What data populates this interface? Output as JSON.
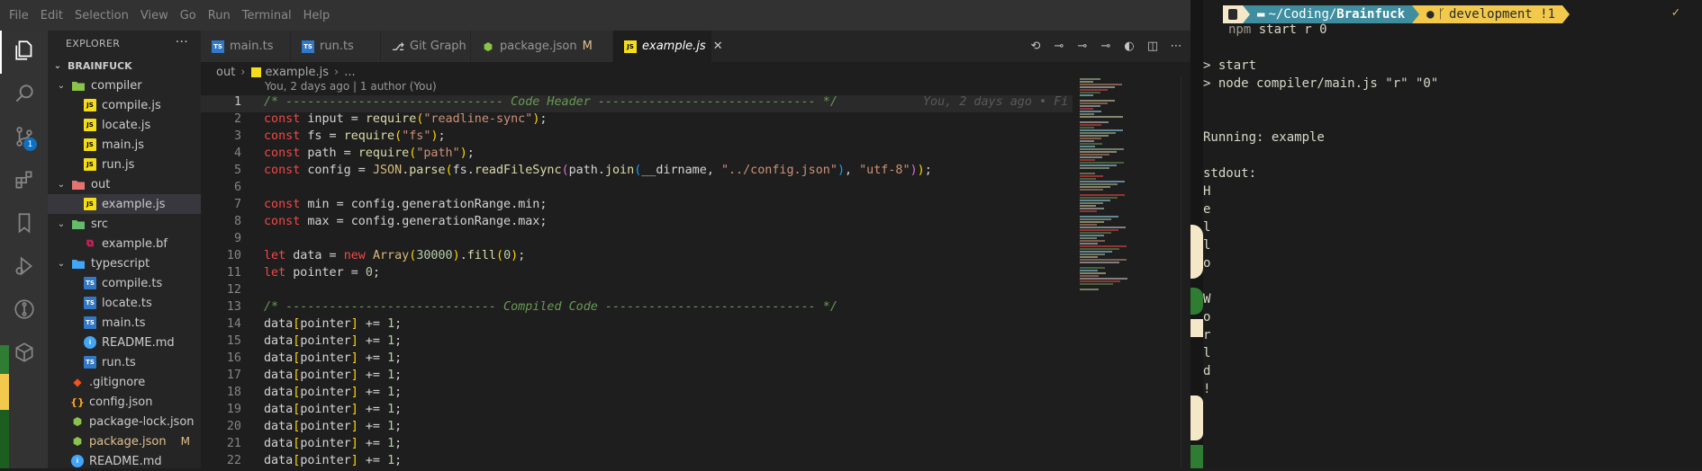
{
  "menubar": {
    "items": [
      "File",
      "Edit",
      "Selection",
      "View",
      "Go",
      "Run",
      "Terminal",
      "Help"
    ]
  },
  "activitybar": {
    "items": [
      {
        "name": "explorer",
        "icon": "files-icon"
      },
      {
        "name": "search",
        "icon": "search-icon"
      },
      {
        "name": "source-control",
        "icon": "source-control-icon",
        "badge": "1"
      },
      {
        "name": "extensions",
        "icon": "extensions-icon"
      },
      {
        "name": "bookmarks",
        "icon": "bookmark-icon"
      },
      {
        "name": "run-debug",
        "icon": "run-debug-icon"
      },
      {
        "name": "git-graph",
        "icon": "git-graph-icon"
      },
      {
        "name": "remote",
        "icon": "remote-icon"
      }
    ]
  },
  "explorer": {
    "title": "EXPLORER",
    "more": "···",
    "root": "BRAINFUCK",
    "tree": [
      {
        "label": "compiler",
        "type": "folder",
        "depth": 1,
        "open": true,
        "color": "#8bc34a"
      },
      {
        "label": "compile.js",
        "type": "js",
        "depth": 2
      },
      {
        "label": "locate.js",
        "type": "js",
        "depth": 2
      },
      {
        "label": "main.js",
        "type": "js",
        "depth": 2
      },
      {
        "label": "run.js",
        "type": "js",
        "depth": 2
      },
      {
        "label": "out",
        "type": "folder",
        "depth": 1,
        "open": true,
        "color": "#e57373"
      },
      {
        "label": "example.js",
        "type": "js",
        "depth": 2,
        "selected": true
      },
      {
        "label": "src",
        "type": "folder",
        "depth": 1,
        "open": true,
        "color": "#66bb6a"
      },
      {
        "label": "example.bf",
        "type": "bf",
        "depth": 2
      },
      {
        "label": "typescript",
        "type": "folder",
        "depth": 1,
        "open": true,
        "color": "#42a5f5"
      },
      {
        "label": "compile.ts",
        "type": "ts",
        "depth": 2
      },
      {
        "label": "locate.ts",
        "type": "ts",
        "depth": 2
      },
      {
        "label": "main.ts",
        "type": "ts",
        "depth": 2
      },
      {
        "label": "README.md",
        "type": "md",
        "depth": 2
      },
      {
        "label": "run.ts",
        "type": "ts",
        "depth": 2
      },
      {
        "label": ".gitignore",
        "type": "git",
        "depth": 1
      },
      {
        "label": "config.json",
        "type": "json",
        "depth": 1
      },
      {
        "label": "package-lock.json",
        "type": "pkg",
        "depth": 1
      },
      {
        "label": "package.json",
        "type": "pkg",
        "depth": 1,
        "git": "M"
      },
      {
        "label": "README.md",
        "type": "md",
        "depth": 1
      }
    ]
  },
  "tabs": [
    {
      "label": "main.ts",
      "type": "ts"
    },
    {
      "label": "run.ts",
      "type": "ts"
    },
    {
      "label": "Git Graph",
      "type": "git-graph"
    },
    {
      "label": "package.json",
      "type": "pkg",
      "git": "M"
    },
    {
      "label": "example.js",
      "type": "js",
      "active": true,
      "close": "✕"
    }
  ],
  "breadcrumb": {
    "folder": "out",
    "file": "example.js",
    "more": "..."
  },
  "blame": {
    "header": "You, 2 days ago | 1 author (You)",
    "inline": "You, 2 days ago • Fi"
  },
  "editor": {
    "current_line": 1,
    "lines": [
      {
        "n": "1",
        "tokens": [
          [
            "cm",
            "/* ------------------------------ Code Header ------------------------------ */"
          ]
        ]
      },
      {
        "n": "2",
        "tokens": [
          [
            "kw",
            "const "
          ],
          [
            "var",
            "input"
          ],
          [
            "plain",
            " = "
          ],
          [
            "fn",
            "require"
          ],
          [
            "br1",
            "("
          ],
          [
            "str",
            "\"readline-sync\""
          ],
          [
            "br1",
            ")"
          ],
          [
            "plain",
            ";"
          ]
        ]
      },
      {
        "n": "3",
        "tokens": [
          [
            "kw",
            "const "
          ],
          [
            "var",
            "fs"
          ],
          [
            "plain",
            " = "
          ],
          [
            "fn",
            "require"
          ],
          [
            "br1",
            "("
          ],
          [
            "str",
            "\"fs\""
          ],
          [
            "br1",
            ")"
          ],
          [
            "plain",
            ";"
          ]
        ]
      },
      {
        "n": "4",
        "tokens": [
          [
            "kw",
            "const "
          ],
          [
            "var",
            "path"
          ],
          [
            "plain",
            " = "
          ],
          [
            "fn",
            "require"
          ],
          [
            "br1",
            "("
          ],
          [
            "str",
            "\"path\""
          ],
          [
            "br1",
            ")"
          ],
          [
            "plain",
            ";"
          ]
        ]
      },
      {
        "n": "5",
        "tokens": [
          [
            "kw",
            "const "
          ],
          [
            "var",
            "config"
          ],
          [
            "plain",
            " = "
          ],
          [
            "yel",
            "JSON"
          ],
          [
            "plain",
            "."
          ],
          [
            "fn",
            "parse"
          ],
          [
            "br1",
            "("
          ],
          [
            "var",
            "fs"
          ],
          [
            "plain",
            "."
          ],
          [
            "fn",
            "readFileSync"
          ],
          [
            "br2",
            "("
          ],
          [
            "var",
            "path"
          ],
          [
            "plain",
            "."
          ],
          [
            "fn",
            "join"
          ],
          [
            "br3",
            "("
          ],
          [
            "var",
            "__dirname"
          ],
          [
            "plain",
            ", "
          ],
          [
            "str",
            "\"../config.json\""
          ],
          [
            "br3",
            ")"
          ],
          [
            "plain",
            ", "
          ],
          [
            "str",
            "\"utf-8\""
          ],
          [
            "br2",
            ")"
          ],
          [
            "br1",
            ")"
          ],
          [
            "plain",
            ";"
          ]
        ]
      },
      {
        "n": "6",
        "tokens": []
      },
      {
        "n": "7",
        "tokens": [
          [
            "kw",
            "const "
          ],
          [
            "var",
            "min"
          ],
          [
            "plain",
            " = "
          ],
          [
            "var",
            "config"
          ],
          [
            "plain",
            "."
          ],
          [
            "var",
            "generationRange"
          ],
          [
            "plain",
            "."
          ],
          [
            "var",
            "min"
          ],
          [
            "plain",
            ";"
          ]
        ]
      },
      {
        "n": "8",
        "tokens": [
          [
            "kw",
            "const "
          ],
          [
            "var",
            "max"
          ],
          [
            "plain",
            " = "
          ],
          [
            "var",
            "config"
          ],
          [
            "plain",
            "."
          ],
          [
            "var",
            "generationRange"
          ],
          [
            "plain",
            "."
          ],
          [
            "var",
            "max"
          ],
          [
            "plain",
            ";"
          ]
        ]
      },
      {
        "n": "9",
        "tokens": []
      },
      {
        "n": "10",
        "tokens": [
          [
            "kw",
            "let "
          ],
          [
            "var",
            "data"
          ],
          [
            "plain",
            " = "
          ],
          [
            "kw",
            "new "
          ],
          [
            "yel",
            "Array"
          ],
          [
            "br1",
            "("
          ],
          [
            "num",
            "30000"
          ],
          [
            "br1",
            ")"
          ],
          [
            "plain",
            "."
          ],
          [
            "fn",
            "fill"
          ],
          [
            "br1",
            "("
          ],
          [
            "num",
            "0"
          ],
          [
            "br1",
            ")"
          ],
          [
            "plain",
            ";"
          ]
        ]
      },
      {
        "n": "11",
        "tokens": [
          [
            "kw",
            "let "
          ],
          [
            "var",
            "pointer"
          ],
          [
            "plain",
            " = "
          ],
          [
            "num",
            "0"
          ],
          [
            "plain",
            ";"
          ]
        ]
      },
      {
        "n": "12",
        "tokens": []
      },
      {
        "n": "13",
        "tokens": [
          [
            "cm",
            "/* ----------------------------- Compiled Code ----------------------------- */"
          ]
        ]
      },
      {
        "n": "14",
        "tokens": [
          [
            "var",
            "data"
          ],
          [
            "br1",
            "["
          ],
          [
            "var",
            "pointer"
          ],
          [
            "br1",
            "]"
          ],
          [
            "plain",
            " += "
          ],
          [
            "num",
            "1"
          ],
          [
            "plain",
            ";"
          ]
        ]
      },
      {
        "n": "15",
        "tokens": [
          [
            "var",
            "data"
          ],
          [
            "br1",
            "["
          ],
          [
            "var",
            "pointer"
          ],
          [
            "br1",
            "]"
          ],
          [
            "plain",
            " += "
          ],
          [
            "num",
            "1"
          ],
          [
            "plain",
            ";"
          ]
        ]
      },
      {
        "n": "16",
        "tokens": [
          [
            "var",
            "data"
          ],
          [
            "br1",
            "["
          ],
          [
            "var",
            "pointer"
          ],
          [
            "br1",
            "]"
          ],
          [
            "plain",
            " += "
          ],
          [
            "num",
            "1"
          ],
          [
            "plain",
            ";"
          ]
        ]
      },
      {
        "n": "17",
        "tokens": [
          [
            "var",
            "data"
          ],
          [
            "br1",
            "["
          ],
          [
            "var",
            "pointer"
          ],
          [
            "br1",
            "]"
          ],
          [
            "plain",
            " += "
          ],
          [
            "num",
            "1"
          ],
          [
            "plain",
            ";"
          ]
        ]
      },
      {
        "n": "18",
        "tokens": [
          [
            "var",
            "data"
          ],
          [
            "br1",
            "["
          ],
          [
            "var",
            "pointer"
          ],
          [
            "br1",
            "]"
          ],
          [
            "plain",
            " += "
          ],
          [
            "num",
            "1"
          ],
          [
            "plain",
            ";"
          ]
        ]
      },
      {
        "n": "19",
        "tokens": [
          [
            "var",
            "data"
          ],
          [
            "br1",
            "["
          ],
          [
            "var",
            "pointer"
          ],
          [
            "br1",
            "]"
          ],
          [
            "plain",
            " += "
          ],
          [
            "num",
            "1"
          ],
          [
            "plain",
            ";"
          ]
        ]
      },
      {
        "n": "20",
        "tokens": [
          [
            "var",
            "data"
          ],
          [
            "br1",
            "["
          ],
          [
            "var",
            "pointer"
          ],
          [
            "br1",
            "]"
          ],
          [
            "plain",
            " += "
          ],
          [
            "num",
            "1"
          ],
          [
            "plain",
            ";"
          ]
        ]
      },
      {
        "n": "21",
        "tokens": [
          [
            "var",
            "data"
          ],
          [
            "br1",
            "["
          ],
          [
            "var",
            "pointer"
          ],
          [
            "br1",
            "]"
          ],
          [
            "plain",
            " += "
          ],
          [
            "num",
            "1"
          ],
          [
            "plain",
            ";"
          ]
        ]
      },
      {
        "n": "22",
        "tokens": [
          [
            "var",
            "data"
          ],
          [
            "br1",
            "["
          ],
          [
            "var",
            "pointer"
          ],
          [
            "br1",
            "]"
          ],
          [
            "plain",
            " += "
          ],
          [
            "num",
            "1"
          ],
          [
            "plain",
            ";"
          ]
        ]
      }
    ]
  },
  "terminal": {
    "prompt": {
      "os_glyph": "🐧",
      "dir_prefix": "~/Coding/",
      "dir_name": "Brainfuck",
      "branch": "development !1",
      "status": "✓"
    },
    "command": {
      "program": "npm",
      "args": " start r 0"
    },
    "output": [
      "",
      "> start",
      "> node compiler/main.js \"r\" \"0\"",
      "",
      "",
      "Running: example",
      "",
      "stdout:",
      "H",
      "e",
      "l",
      "l",
      "o",
      "",
      "W",
      "o",
      "r",
      "l",
      "d",
      "!"
    ]
  },
  "colors": {
    "accent": "#0e70c0",
    "modified": "#e2c08d",
    "git_branch_bg": "#f2c94c",
    "dir_bg": "#3e8ea0"
  }
}
